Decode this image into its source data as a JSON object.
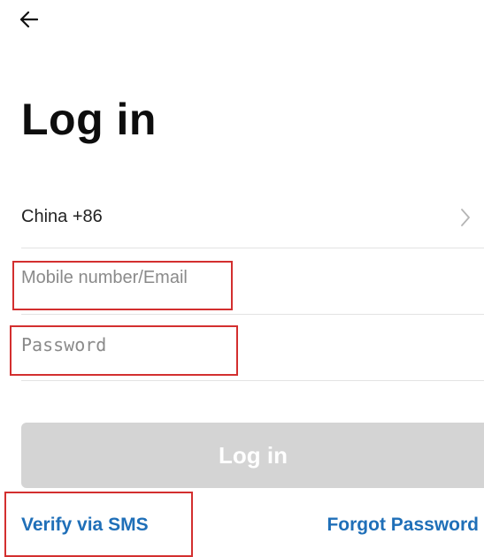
{
  "header": {
    "back_icon": "arrow-left-icon"
  },
  "page": {
    "title": "Log in"
  },
  "form": {
    "country_label": "China +86",
    "country_chevron_icon": "chevron-right-icon",
    "mobile_value": "",
    "mobile_placeholder": "Mobile number/Email",
    "password_value": "",
    "password_placeholder": "Password",
    "login_button_label": "Log in"
  },
  "links": {
    "verify_sms": "Verify via SMS",
    "forgot_password": "Forgot Password"
  },
  "colors": {
    "link": "#1f6fb8",
    "button_disabled_bg": "#d4d4d4",
    "highlight_border": "#d32f2f",
    "divider": "#e3e3e3"
  }
}
